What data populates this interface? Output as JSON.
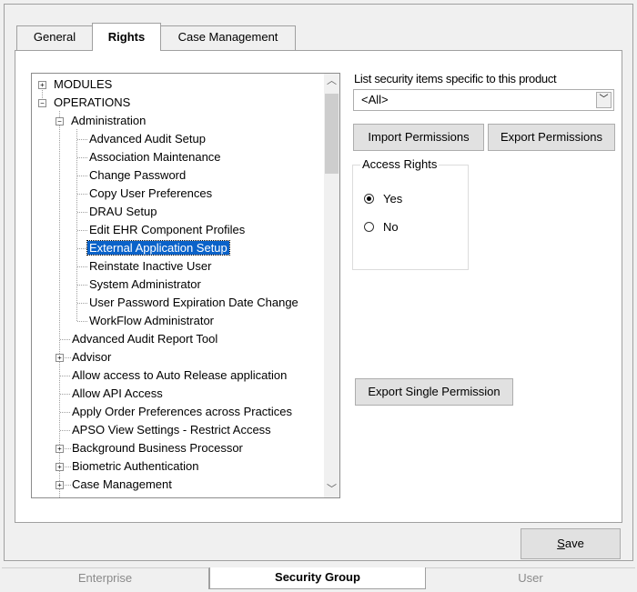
{
  "tabs": [
    {
      "label": "General"
    },
    {
      "label": "Rights"
    },
    {
      "label": "Case Management"
    }
  ],
  "tree": {
    "items": [
      {
        "label": "MODULES"
      },
      {
        "label": "OPERATIONS"
      },
      {
        "label": "Administration"
      },
      {
        "label": "Advanced Audit Setup"
      },
      {
        "label": "Association Maintenance"
      },
      {
        "label": "Change Password"
      },
      {
        "label": "Copy User Preferences"
      },
      {
        "label": "DRAU Setup"
      },
      {
        "label": "Edit EHR Component Profiles"
      },
      {
        "label": "External Application Setup"
      },
      {
        "label": "Reinstate Inactive User"
      },
      {
        "label": "System Administrator"
      },
      {
        "label": "User Password Expiration Date Change"
      },
      {
        "label": "WorkFlow Administrator"
      },
      {
        "label": "Advanced Audit Report Tool"
      },
      {
        "label": "Advisor"
      },
      {
        "label": "Allow access to Auto Release application"
      },
      {
        "label": "Allow API Access"
      },
      {
        "label": "Apply Order Preferences across Practices"
      },
      {
        "label": "APSO View Settings  - Restrict Access"
      },
      {
        "label": "Background Business Processor"
      },
      {
        "label": "Biometric Authentication"
      },
      {
        "label": "Case Management"
      }
    ]
  },
  "filter": {
    "label": "List security items specific to this product",
    "value": "<All>"
  },
  "buttons": {
    "import": "Import Permissions",
    "export": "Export Permissions",
    "export_single": "Export Single Permission",
    "save_s": "S",
    "save_rest": "ave"
  },
  "access_rights": {
    "legend": "Access Rights",
    "yes": "Yes",
    "no": "No",
    "selected": "Yes"
  },
  "bottom_tabs": [
    {
      "label": "Enterprise"
    },
    {
      "label": "Security Group"
    },
    {
      "label": "User"
    }
  ]
}
